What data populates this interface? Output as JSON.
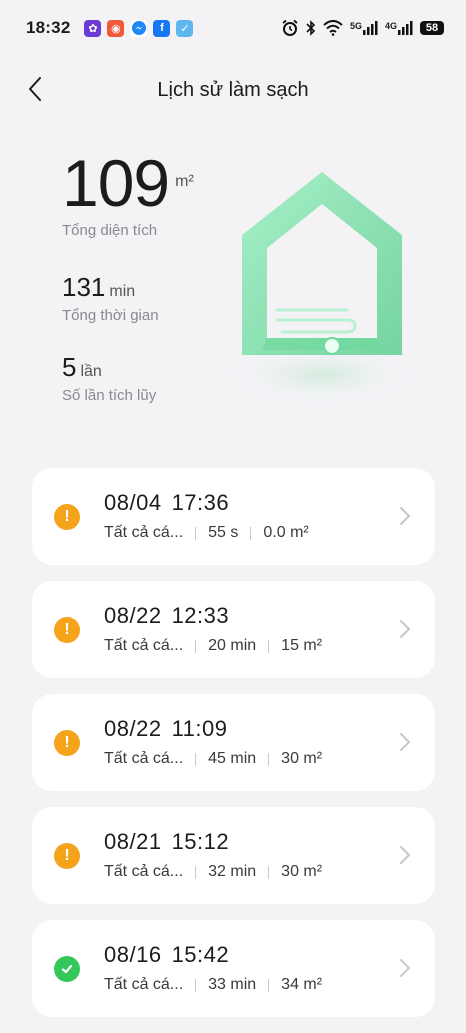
{
  "status_bar": {
    "time": "18:32",
    "net1": "5G",
    "net2": "4G",
    "battery": "58",
    "apps": [
      {
        "name": "app-1",
        "color": "#6b3bd6"
      },
      {
        "name": "app-2",
        "color": "#f05a3a"
      },
      {
        "name": "messenger",
        "color": "#ffffff"
      },
      {
        "name": "facebook",
        "color": "#1877f2"
      },
      {
        "name": "check-app",
        "color": "#5fb7f0"
      }
    ]
  },
  "header": {
    "title": "Lịch sử làm sạch"
  },
  "stats": {
    "area": {
      "value": "109",
      "unit": "m²",
      "label": "Tổng diện tích"
    },
    "time": {
      "value": "131",
      "unit": "min",
      "label": "Tổng thời gian"
    },
    "count": {
      "value": "5",
      "unit": "lần",
      "label": "Số lần tích lũy"
    }
  },
  "colors": {
    "warning": "#f5a31a",
    "success": "#34c759",
    "house": "#7ee0a8"
  },
  "records": [
    {
      "date": "08/04",
      "time": "17:36",
      "mode": "Tất cả cá...",
      "duration": "55 s",
      "area": "0.0 m²",
      "status": "warning"
    },
    {
      "date": "08/22",
      "time": "12:33",
      "mode": "Tất cả cá...",
      "duration": "20 min",
      "area": "15 m²",
      "status": "warning"
    },
    {
      "date": "08/22",
      "time": "11:09",
      "mode": "Tất cả cá...",
      "duration": "45 min",
      "area": "30 m²",
      "status": "warning"
    },
    {
      "date": "08/21",
      "time": "15:12",
      "mode": "Tất cả cá...",
      "duration": "32 min",
      "area": "30 m²",
      "status": "warning"
    },
    {
      "date": "08/16",
      "time": "15:42",
      "mode": "Tất cả cá...",
      "duration": "33 min",
      "area": "34 m²",
      "status": "success"
    }
  ]
}
